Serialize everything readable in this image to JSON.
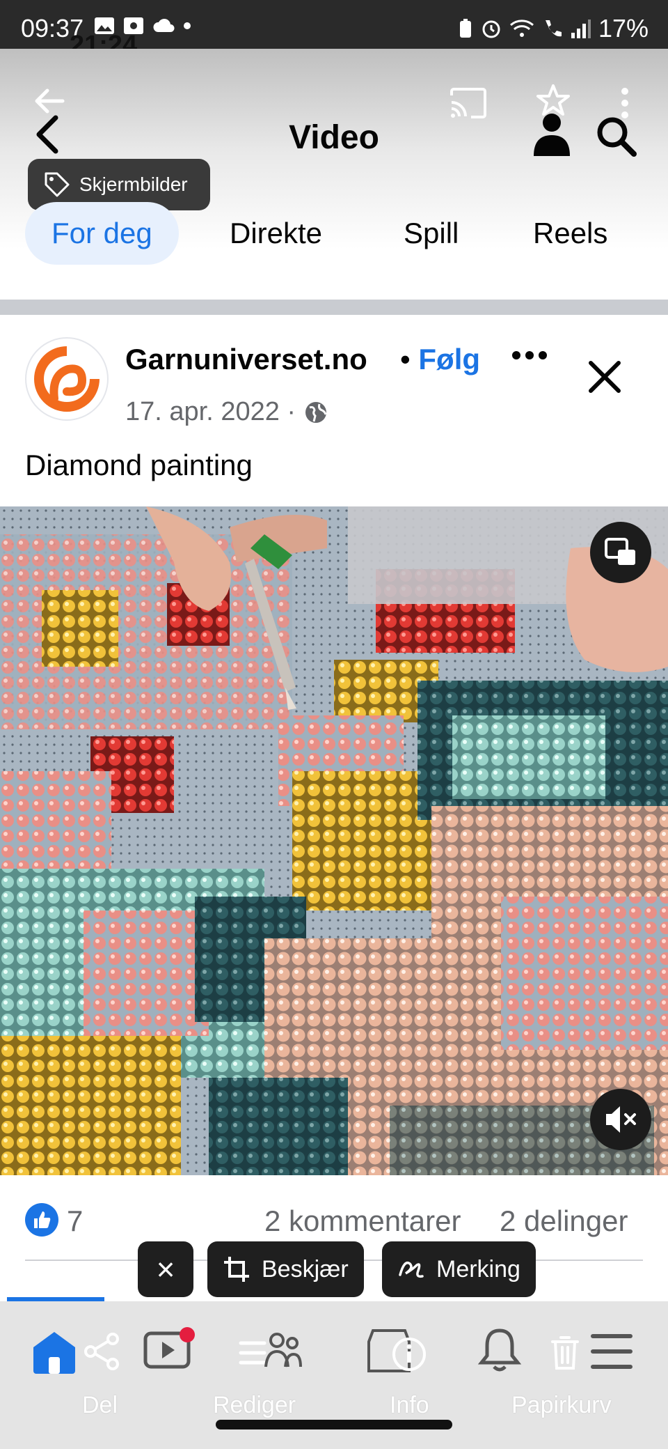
{
  "status_bar": {
    "time": "09:37",
    "battery": "17%",
    "ghost_time": "21:24"
  },
  "header": {
    "title": "Video",
    "tooltip": "Skjermbilder"
  },
  "tabs": [
    {
      "label": "For deg",
      "active": true
    },
    {
      "label": "Direkte",
      "active": false
    },
    {
      "label": "Spill",
      "active": false
    },
    {
      "label": "Reels",
      "active": false
    }
  ],
  "post": {
    "author": "Garnuniverset.no",
    "separator": "•",
    "follow_label": "Følg",
    "date": "17. apr. 2022 ·",
    "caption": "Diamond painting"
  },
  "reactions": {
    "like_count": "7",
    "comments": "2 kommentarer",
    "shares": "2 delinger"
  },
  "editor_pills": {
    "close": "×",
    "crop": "Beskjær",
    "markup": "Merking"
  },
  "bottom_nav": {
    "share_label": "Del",
    "edit_label": "Rediger",
    "info_label": "Info",
    "trash_label": "Papirkurv"
  },
  "colors": {
    "accent": "#1b74e4",
    "tab_active_bg": "#e7f0fd",
    "avatar_orange": "#f26b1d"
  }
}
